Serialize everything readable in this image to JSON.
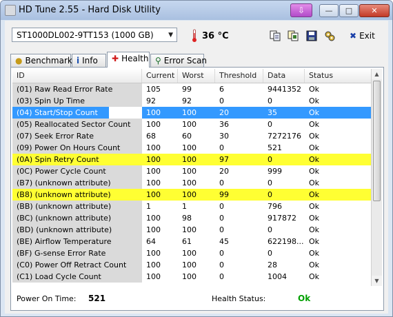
{
  "window": {
    "title": "HD Tune 2.55 - Hard Disk Utility"
  },
  "toolbar": {
    "drive": "ST1000DL002-9TT153 (1000 GB)",
    "temperature": "36 °C",
    "exit_label": "Exit",
    "icons": [
      "copy-icon",
      "copy-all-icon",
      "save-icon",
      "options-icon"
    ]
  },
  "tabs": [
    {
      "label": "Benchmark",
      "icon": "benchmark-icon"
    },
    {
      "label": "Info",
      "icon": "info-icon"
    },
    {
      "label": "Health",
      "icon": "health-icon",
      "active": true
    },
    {
      "label": "Error Scan",
      "icon": "magnifier-icon"
    }
  ],
  "table": {
    "columns": [
      "ID",
      "Current",
      "Worst",
      "Threshold",
      "Data",
      "Status"
    ],
    "rows": [
      [
        "(01) Raw Read Error Rate",
        "105",
        "99",
        "6",
        "9441352",
        "Ok"
      ],
      [
        "(03) Spin Up Time",
        "92",
        "92",
        "0",
        "0",
        "Ok"
      ],
      [
        "(04) Start/Stop Count",
        "100",
        "100",
        "20",
        "35",
        "Ok"
      ],
      [
        "(05) Reallocated Sector Count",
        "100",
        "100",
        "36",
        "0",
        "Ok"
      ],
      [
        "(07) Seek Error Rate",
        "68",
        "60",
        "30",
        "7272176",
        "Ok"
      ],
      [
        "(09) Power On Hours Count",
        "100",
        "100",
        "0",
        "521",
        "Ok"
      ],
      [
        "(0A) Spin Retry Count",
        "100",
        "100",
        "97",
        "0",
        "Ok"
      ],
      [
        "(0C) Power Cycle Count",
        "100",
        "100",
        "20",
        "999",
        "Ok"
      ],
      [
        "(B7) (unknown attribute)",
        "100",
        "100",
        "0",
        "0",
        "Ok"
      ],
      [
        "(B8) (unknown attribute)",
        "100",
        "100",
        "99",
        "0",
        "Ok"
      ],
      [
        "(BB) (unknown attribute)",
        "1",
        "1",
        "0",
        "796",
        "Ok"
      ],
      [
        "(BC) (unknown attribute)",
        "100",
        "98",
        "0",
        "917872",
        "Ok"
      ],
      [
        "(BD) (unknown attribute)",
        "100",
        "100",
        "0",
        "0",
        "Ok"
      ],
      [
        "(BE) Airflow Temperature",
        "64",
        "61",
        "45",
        "622198...",
        "Ok"
      ],
      [
        "(BF) G-sense Error Rate",
        "100",
        "100",
        "0",
        "0",
        "Ok"
      ],
      [
        "(C0) Power Off Retract Count",
        "100",
        "100",
        "0",
        "28",
        "Ok"
      ],
      [
        "(C1) Load Cycle Count",
        "100",
        "100",
        "0",
        "1004",
        "Ok"
      ]
    ],
    "selected_row": 2,
    "warning_rows": [
      6,
      9
    ],
    "colors": {
      "selected": "#3399ff",
      "warning": "#ffff33",
      "id_column": "#dadada"
    }
  },
  "footer": {
    "power_on_label": "Power On Time:",
    "power_on_value": "521",
    "health_label": "Health Status:",
    "health_value": "Ok",
    "health_color": "#00a000"
  }
}
